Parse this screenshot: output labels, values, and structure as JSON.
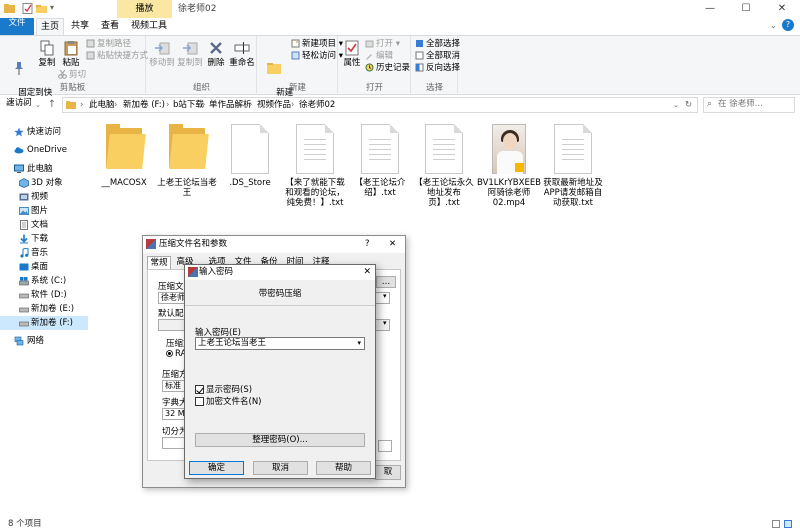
{
  "window": {
    "play_tab": "播放",
    "title": "徐老师02",
    "minimize": "—",
    "maximize": "☐",
    "close": "✕"
  },
  "tabs": [
    "文件",
    "主页",
    "共享",
    "查看",
    "视频工具"
  ],
  "ribbon": {
    "clipboard": {
      "label": "剪贴板",
      "pin": "固定到快\n速访问",
      "copy": "复制",
      "paste": "粘贴",
      "copy_path": "复制路径",
      "paste_shortcut": "粘贴快捷方式",
      "cut": "剪切"
    },
    "organize": {
      "label": "组织",
      "move_to": "移动到",
      "copy_to": "复制到",
      "delete": "删除",
      "rename": "重命名"
    },
    "new": {
      "label": "新建",
      "new_folder": "新建\n文件夹",
      "new_item": "新建项目",
      "easy_access": "轻松访问"
    },
    "open": {
      "label": "打开",
      "properties": "属性",
      "open": "打开",
      "edit": "编辑",
      "history": "历史记录"
    },
    "select": {
      "label": "选择",
      "select_all": "全部选择",
      "select_none": "全部取消",
      "invert": "反向选择"
    }
  },
  "address": {
    "crumbs": [
      "此电脑",
      "新加卷 (F:)",
      "b站下载",
      "单作品解析",
      "视频作品",
      "徐老师02"
    ],
    "search_placeholder": "在 徐老师..."
  },
  "nav": {
    "quick_access": "快速访问",
    "onedrive": "OneDrive",
    "this_pc": "此电脑",
    "objects3d": "3D 对象",
    "videos": "视频",
    "pictures": "图片",
    "documents": "文档",
    "downloads": "下载",
    "music": "音乐",
    "desktop": "桌面",
    "drive_c": "系统 (C:)",
    "drive_d": "软件 (D:)",
    "drive_e": "新加卷 (E:)",
    "drive_f": "新加卷 (F:)",
    "network": "网络"
  },
  "files": [
    {
      "name": "__MACOSX",
      "type": "folder"
    },
    {
      "name": "上老王论坛当老王",
      "type": "folder"
    },
    {
      "name": ".DS_Store",
      "type": "file"
    },
    {
      "name": "【来了就能下载和观看的论坛，纯免费！】.txt",
      "type": "txt"
    },
    {
      "name": "【老王论坛介绍】.txt",
      "type": "txt"
    },
    {
      "name": "【老王论坛永久地址发布页】.txt",
      "type": "txt"
    },
    {
      "name": "BV1LKrYBXEEB 阿骑徐老师02.mp4",
      "type": "video"
    },
    {
      "name": "获取最新地址及APP请发邮箱自动获取.txt",
      "type": "txt"
    }
  ],
  "status": {
    "count": "8 个项目"
  },
  "archive_dialog": {
    "title": "压缩文件名和参数",
    "help": "?",
    "close": "✕",
    "tabs": [
      "常规",
      "高级",
      "选项",
      "文件",
      "备份",
      "时间",
      "注释"
    ],
    "archive_name_label": "压缩文件",
    "archive_name_value": "徐老师0",
    "default_profile_label": "默认配置",
    "format_label": "压缩文",
    "format_value": "RAR",
    "method_label": "压缩方式",
    "method_value": "标准",
    "dict_label": "字典大小",
    "dict_value": "32 MB",
    "split_label": "切分为分",
    "cancel_fragment": "取"
  },
  "password_dialog": {
    "title": "输入密码",
    "close": "✕",
    "subtitle": "带密码压缩",
    "password_label": "输入密码(E)",
    "password_value": "上老王论坛当老王",
    "show_password": "显示密码(S)",
    "show_password_checked": true,
    "encrypt_names": "加密文件名(N)",
    "encrypt_names_checked": false,
    "manage": "整理密码(O)...",
    "ok": "确定",
    "cancel": "取消",
    "help": "帮助"
  }
}
